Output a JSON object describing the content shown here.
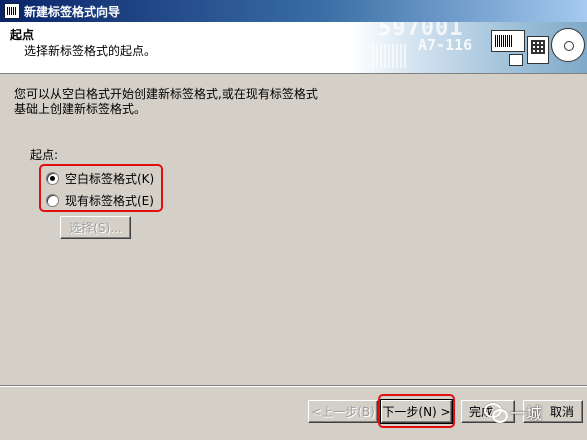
{
  "window": {
    "title": "新建标签格式向导"
  },
  "header": {
    "title": "起点",
    "subtitle": "选择新标签格式的起点。",
    "banner_code_1": "597001",
    "banner_code_2": "A7-116"
  },
  "body": {
    "description_line1": "您可以从空白格式开始创建新标签格式,或在现有标签格式",
    "description_line2": "基础上创建新标签格式。",
    "start_label": "起点:",
    "options": [
      {
        "label": "空白标签格式(K)",
        "checked": true
      },
      {
        "label": "现有标签格式(E)",
        "checked": false
      }
    ],
    "select_button": "选择(S)..."
  },
  "footer": {
    "back_button": "<上一步(B)",
    "next_button": "下一步(N) >",
    "finish_button": "完成",
    "cancel_button": "取消",
    "watermark_text": "一城"
  },
  "colors": {
    "highlight": "#e01010",
    "dialog_bg": "#d4d0c8",
    "titlebar_start": "#0a246a"
  }
}
